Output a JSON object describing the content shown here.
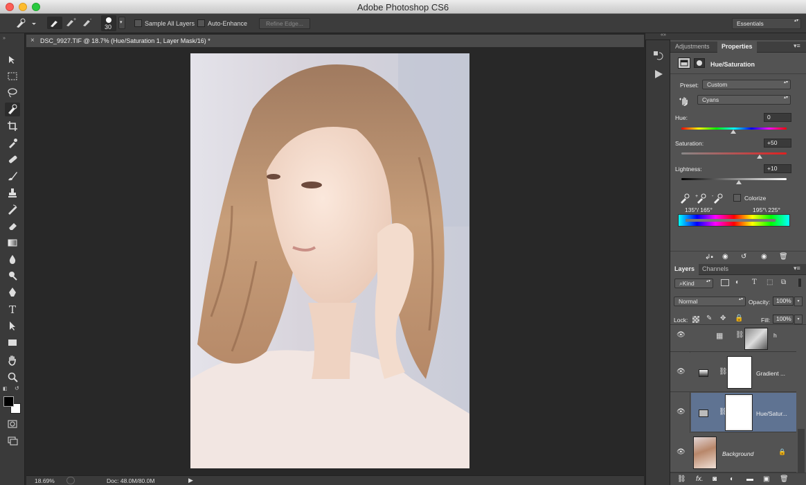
{
  "window": {
    "title": "Adobe Photoshop CS6"
  },
  "options": {
    "brush_size": "30",
    "sample_all_layers": "Sample All Layers",
    "auto_enhance": "Auto-Enhance",
    "refine_edge": "Refine Edge...",
    "workspace": "Essentials"
  },
  "document": {
    "tab_title": "DSC_9927.TIF @ 18.7% (Hue/Saturation 1, Layer Mask/16) *",
    "tab_close": "×",
    "zoom": "18.69%",
    "doc_size": "Doc: 48.0M/80.0M"
  },
  "properties": {
    "tabs": [
      "Adjustments",
      "Properties"
    ],
    "panel_title": "Hue/Saturation",
    "preset_label": "Preset:",
    "preset_value": "Custom",
    "channel_value": "Cyans",
    "hue": {
      "label": "Hue:",
      "value": "0",
      "level": 0
    },
    "saturation": {
      "label": "Saturation:",
      "value": "+50",
      "level": 50
    },
    "lightness": {
      "label": "Lightness:",
      "value": "+10",
      "level": 10
    },
    "colorize": "Colorize",
    "range_left": "135°/ 165°",
    "range_right": "195°\\ 225°"
  },
  "layers_panel": {
    "tabs": [
      "Layers",
      "Channels"
    ],
    "kind": "Kind",
    "blend_mode": "Normal",
    "opacity_label": "Opacity:",
    "opacity_value": "100%",
    "lock_label": "Lock:",
    "fill_label": "Fill:",
    "fill_value": "100%",
    "layers": [
      {
        "name": "h"
      },
      {
        "name": "Gradient ..."
      },
      {
        "name": "Hue/Satur..."
      },
      {
        "name": "Background"
      }
    ],
    "footer_fx": "fx."
  },
  "colors": {
    "accent": "#5f7392",
    "panel": "#535353",
    "dark": "#282828"
  }
}
